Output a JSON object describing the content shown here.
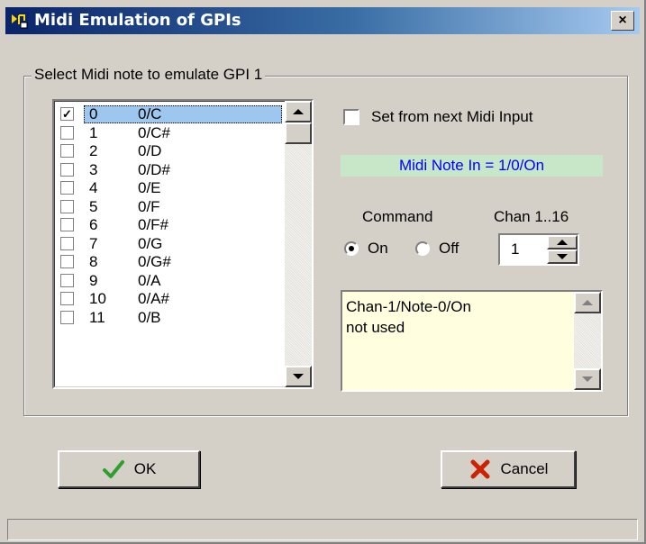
{
  "window": {
    "title": "Midi Emulation of GPIs",
    "close_label": "×"
  },
  "group": {
    "label": "Select Midi note to emulate GPI 1"
  },
  "note_list": {
    "items": [
      {
        "num": "0",
        "note": "0/C",
        "checked": true,
        "selected": true
      },
      {
        "num": "1",
        "note": "0/C#",
        "checked": false,
        "selected": false
      },
      {
        "num": "2",
        "note": "0/D",
        "checked": false,
        "selected": false
      },
      {
        "num": "3",
        "note": "0/D#",
        "checked": false,
        "selected": false
      },
      {
        "num": "4",
        "note": "0/E",
        "checked": false,
        "selected": false
      },
      {
        "num": "5",
        "note": "0/F",
        "checked": false,
        "selected": false
      },
      {
        "num": "6",
        "note": "0/F#",
        "checked": false,
        "selected": false
      },
      {
        "num": "7",
        "note": "0/G",
        "checked": false,
        "selected": false
      },
      {
        "num": "8",
        "note": "0/G#",
        "checked": false,
        "selected": false
      },
      {
        "num": "9",
        "note": "0/A",
        "checked": false,
        "selected": false
      },
      {
        "num": "10",
        "note": "0/A#",
        "checked": false,
        "selected": false
      },
      {
        "num": "11",
        "note": "0/B",
        "checked": false,
        "selected": false
      }
    ],
    "check_glyph": "✓"
  },
  "set_from_next": {
    "label": "Set from next Midi Input",
    "checked": false
  },
  "midi_status": {
    "text": "Midi Note In = 1/0/On",
    "text_color": "#0000ff",
    "background": "#c8e6c8"
  },
  "command": {
    "label": "Command",
    "options": [
      {
        "label": "On",
        "selected": true
      },
      {
        "label": "Off",
        "selected": false
      }
    ]
  },
  "channel": {
    "label": "Chan 1..16",
    "value": "1"
  },
  "info_memo": {
    "lines": [
      "Chan-1/Note-0/On",
      "not used"
    ],
    "background": "#ffffe0"
  },
  "buttons": {
    "ok_label": "OK",
    "cancel_label": "Cancel"
  },
  "colors": {
    "dialog_face": "#d4d0c8",
    "title_bar": "#0a246a",
    "selection": "#9ec7ef",
    "ok_icon": "#2e9e2e",
    "cancel_icon": "#cc2200"
  }
}
